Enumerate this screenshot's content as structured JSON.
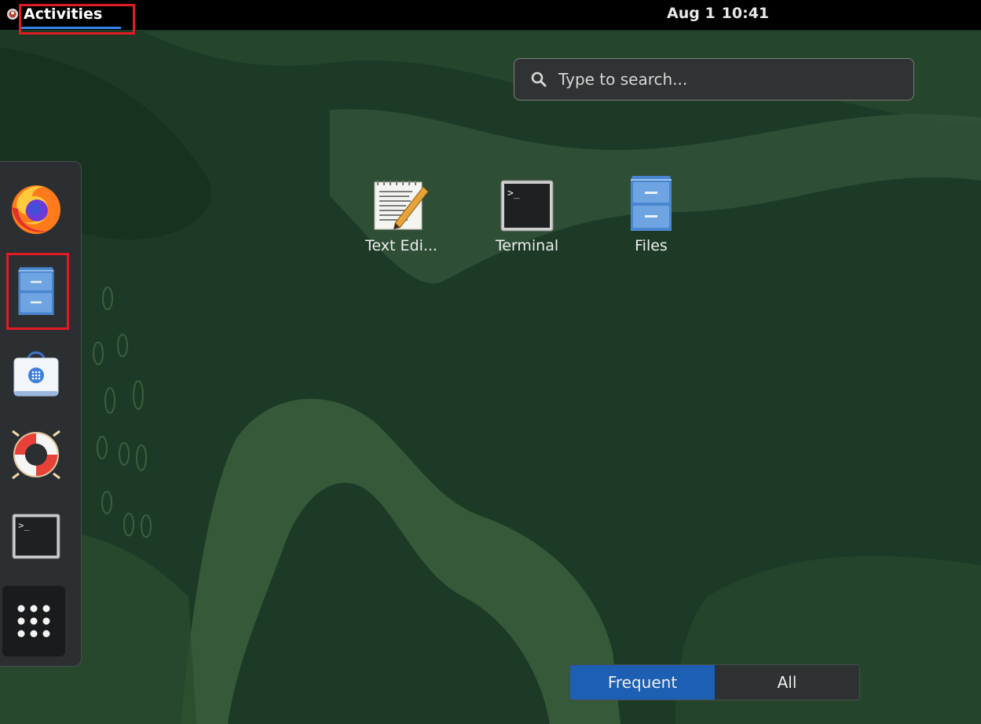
{
  "topbar": {
    "activities_label": "Activities",
    "date": "Aug 1",
    "time": "10:41"
  },
  "search": {
    "placeholder": "Type to search...",
    "icon": "search-icon"
  },
  "app_grid": [
    {
      "label": "Text Edi...",
      "icon": "text-editor-icon"
    },
    {
      "label": "Terminal",
      "icon": "terminal-icon"
    },
    {
      "label": "Files",
      "icon": "files-icon"
    }
  ],
  "dash": {
    "items": [
      {
        "name": "Firefox",
        "icon": "firefox-icon"
      },
      {
        "name": "Files",
        "icon": "files-icon"
      },
      {
        "name": "Software",
        "icon": "software-icon"
      },
      {
        "name": "Help",
        "icon": "help-icon"
      },
      {
        "name": "Terminal",
        "icon": "terminal-icon"
      }
    ],
    "show_apps_icon": "grid-icon"
  },
  "view_switcher": {
    "tabs": [
      "Frequent",
      "All"
    ],
    "active": "Frequent"
  },
  "colors": {
    "accent": "#1c5fb3",
    "highlight": "#e01b24",
    "wallpaper": "#1f3d28"
  }
}
